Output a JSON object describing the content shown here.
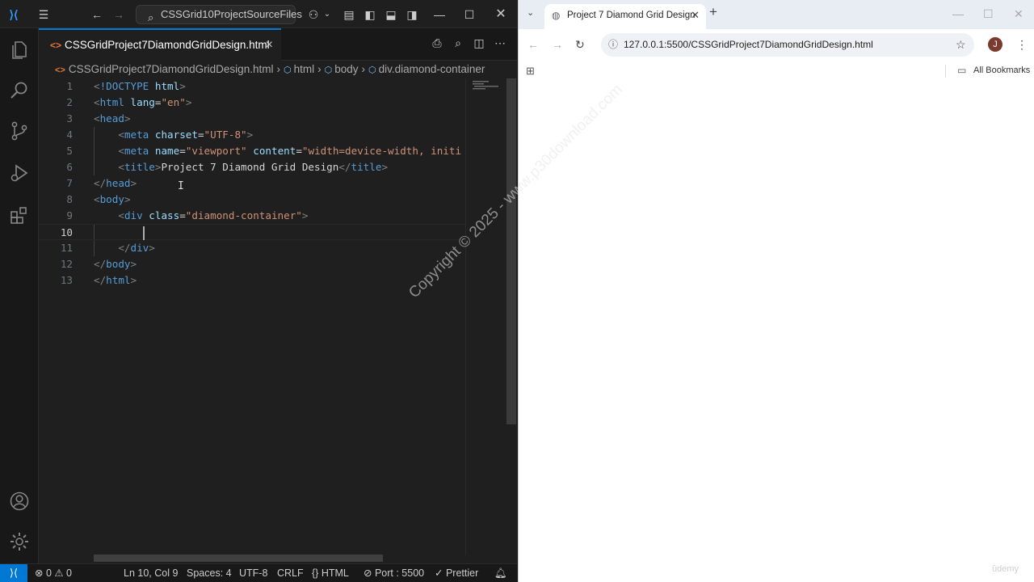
{
  "vscode": {
    "command_center": "CSSGrid10ProjectSourceFiles",
    "tab": {
      "label": "CSSGridProject7DiamondGridDesign.html",
      "close": "×"
    },
    "breadcrumb": [
      "CSSGridProject7DiamondGridDesign.html",
      "html",
      "body",
      "div.diamond-container"
    ],
    "editor": {
      "current_line": 10,
      "lines": [
        {
          "num": "1"
        },
        {
          "num": "2"
        },
        {
          "num": "3"
        },
        {
          "num": "4"
        },
        {
          "num": "5"
        },
        {
          "num": "6"
        },
        {
          "num": "7"
        },
        {
          "num": "8"
        },
        {
          "num": "9"
        },
        {
          "num": "10"
        },
        {
          "num": "11"
        },
        {
          "num": "12"
        },
        {
          "num": "13"
        }
      ]
    },
    "status": {
      "errors": "⊗ 0 ⚠ 0",
      "cursor": "Ln 10, Col 9",
      "spaces": "Spaces: 4",
      "encoding": "UTF-8",
      "eol": "CRLF",
      "language": "{} HTML",
      "port": "⊘ Port : 5500",
      "prettier": "✓ Prettier"
    }
  },
  "browser": {
    "tab_title": "Project 7 Diamond Grid Design",
    "url": "127.0.0.1:5500/CSSGridProject7DiamondGridDesign.html",
    "avatar_letter": "J",
    "bookmarks_label": "All Bookmarks"
  },
  "overlay": {
    "watermark": "Copyright © 2025 - www.p30download.com",
    "brand": "ûdemy"
  },
  "colors": {
    "accent": "#0078d4",
    "tag": "#569cd6",
    "attr": "#9cdcfe",
    "string": "#ce9178"
  }
}
